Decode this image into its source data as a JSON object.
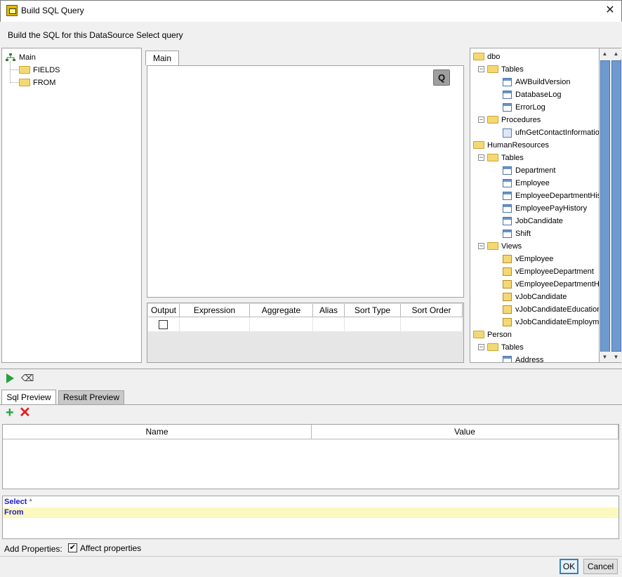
{
  "window": {
    "title": "Build SQL Query",
    "close_glyph": "✕"
  },
  "subtitle": "Build the SQL for this DataSource Select query",
  "left_tree": [
    {
      "label": "Main",
      "icon": "tree-root-icon"
    },
    {
      "label": "FIELDS",
      "icon": "folder-icon"
    },
    {
      "label": "FROM",
      "icon": "folder-icon"
    }
  ],
  "center": {
    "tab": "Main",
    "q_button": "Q",
    "grid_columns": [
      "Output",
      "Expression",
      "Aggregate",
      "Alias",
      "Sort Type",
      "Sort Order"
    ]
  },
  "schema_tree": [
    {
      "label": "dbo",
      "level": 0,
      "icon": "folder"
    },
    {
      "label": "Tables",
      "level": 1,
      "icon": "folder"
    },
    {
      "label": "AWBuildVersion",
      "level": 2,
      "icon": "table"
    },
    {
      "label": "DatabaseLog",
      "level": 2,
      "icon": "table"
    },
    {
      "label": "ErrorLog",
      "level": 2,
      "icon": "table"
    },
    {
      "label": "Procedures",
      "level": 1,
      "icon": "folder"
    },
    {
      "label": "ufnGetContactInformation",
      "level": 2,
      "icon": "procedure"
    },
    {
      "label": "HumanResources",
      "level": 0,
      "icon": "folder"
    },
    {
      "label": "Tables",
      "level": 1,
      "icon": "folder"
    },
    {
      "label": "Department",
      "level": 2,
      "icon": "table"
    },
    {
      "label": "Employee",
      "level": 2,
      "icon": "table"
    },
    {
      "label": "EmployeeDepartmentHist",
      "level": 2,
      "icon": "table"
    },
    {
      "label": "EmployeePayHistory",
      "level": 2,
      "icon": "table"
    },
    {
      "label": "JobCandidate",
      "level": 2,
      "icon": "table"
    },
    {
      "label": "Shift",
      "level": 2,
      "icon": "table"
    },
    {
      "label": "Views",
      "level": 1,
      "icon": "folder"
    },
    {
      "label": "vEmployee",
      "level": 2,
      "icon": "view"
    },
    {
      "label": "vEmployeeDepartment",
      "level": 2,
      "icon": "view"
    },
    {
      "label": "vEmployeeDepartmentHis",
      "level": 2,
      "icon": "view"
    },
    {
      "label": "vJobCandidate",
      "level": 2,
      "icon": "view"
    },
    {
      "label": "vJobCandidateEducation",
      "level": 2,
      "icon": "view"
    },
    {
      "label": "vJobCandidateEmployme",
      "level": 2,
      "icon": "view"
    },
    {
      "label": "Person",
      "level": 0,
      "icon": "folder"
    },
    {
      "label": "Tables",
      "level": 1,
      "icon": "folder"
    },
    {
      "label": "Address",
      "level": 2,
      "icon": "table"
    }
  ],
  "preview_tabs": {
    "sql": "Sql Preview",
    "result": "Result Preview"
  },
  "props_table": {
    "columns": [
      "Name",
      "Value"
    ]
  },
  "sql": {
    "line1_keyword": "Select",
    "line1_rest": " *",
    "line2_keyword": "From"
  },
  "add_properties": {
    "label": "Add Properties:",
    "checkbox_label": "Affect properties",
    "checked": true,
    "check_glyph": "✔"
  },
  "buttons": {
    "ok": "OK",
    "cancel": "Cancel"
  },
  "colors": {
    "accent": "#3c7fb1",
    "run": "#22a33a",
    "remove": "#e02020",
    "sql_keyword": "#2020c0",
    "highlight": "#fbf8c0"
  }
}
